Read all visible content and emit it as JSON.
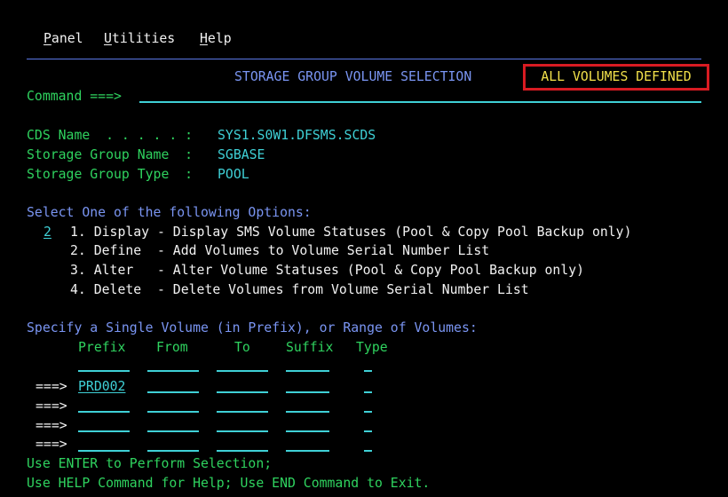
{
  "menu": {
    "panel_hot": "P",
    "panel_rest": "anel",
    "utilities_hot": "U",
    "utilities_rest": "tilities",
    "help_hot": "H",
    "help_rest": "elp"
  },
  "header": {
    "title": "STORAGE GROUP VOLUME SELECTION",
    "status": "ALL VOLUMES DEFINED"
  },
  "command": {
    "label": "Command ===>",
    "value": ""
  },
  "info": {
    "cds_label": "CDS Name  . . . . . :",
    "cds_value": "SYS1.S0W1.DFSMS.SCDS",
    "sg_name_label": "Storage Group Name  :",
    "sg_name_value": "SGBASE",
    "sg_type_label": "Storage Group Type  :",
    "sg_type_value": "POOL"
  },
  "options": {
    "heading": "Select One of the following Options:",
    "selected": "2",
    "items": [
      "1. Display - Display SMS Volume Statuses (Pool & Copy Pool Backup only)",
      "2. Define  - Add Volumes to Volume Serial Number List",
      "3. Alter   - Alter Volume Statuses (Pool & Copy Pool Backup only)",
      "4. Delete  - Delete Volumes from Volume Serial Number List"
    ]
  },
  "volumes": {
    "heading": "Specify a Single Volume (in Prefix), or Range of Volumes:",
    "columns": [
      "Prefix",
      "From",
      "To",
      "Suffix",
      "Type"
    ],
    "arrow": "===>",
    "rows": [
      {
        "prefix": "PRD002",
        "from": "",
        "to": "",
        "suffix": "",
        "type": ""
      },
      {
        "prefix": "",
        "from": "",
        "to": "",
        "suffix": "",
        "type": ""
      },
      {
        "prefix": "",
        "from": "",
        "to": "",
        "suffix": "",
        "type": ""
      },
      {
        "prefix": "",
        "from": "",
        "to": "",
        "suffix": "",
        "type": ""
      }
    ]
  },
  "footer": {
    "line1": "Use ENTER to Perform Selection;",
    "line2": "Use HELP Command for Help; Use END Command to Exit."
  }
}
